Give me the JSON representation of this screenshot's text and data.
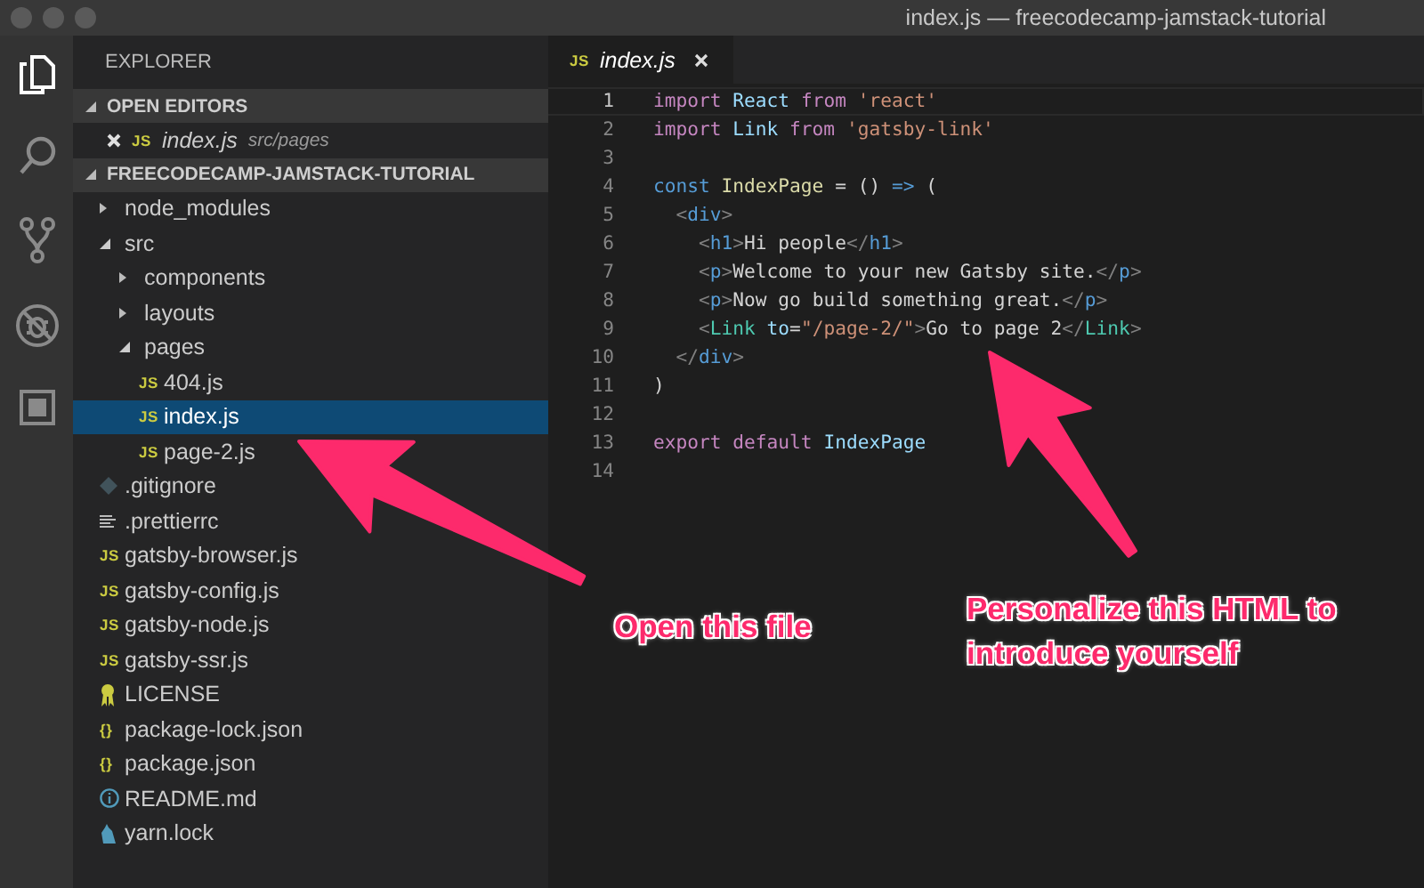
{
  "window": {
    "title": "index.js — freecodecamp-jamstack-tutorial"
  },
  "activity_bar": [
    {
      "kind": "files",
      "selected": true
    },
    {
      "kind": "search",
      "selected": false
    },
    {
      "kind": "source-control",
      "selected": false
    },
    {
      "kind": "debug",
      "selected": false
    },
    {
      "kind": "extensions",
      "selected": false
    }
  ],
  "sidebar": {
    "title": "EXPLORER",
    "sections": [
      {
        "title": "OPEN EDITORS",
        "expanded": true,
        "open_editors": [
          {
            "name": "index.js",
            "path": "src/pages",
            "kind": "js",
            "icon_text": "JS"
          }
        ]
      },
      {
        "title": "FREECODECAMP-JAMSTACK-TUTORIAL",
        "expanded": true,
        "tree": [
          {
            "name": "node_modules",
            "kind": "folder",
            "expanded": false,
            "selected": false
          },
          {
            "name": "src",
            "kind": "folder",
            "expanded": true,
            "selected": false,
            "children": [
              {
                "name": "components",
                "kind": "folder",
                "expanded": false,
                "selected": false
              },
              {
                "name": "layouts",
                "kind": "folder",
                "expanded": false,
                "selected": false
              },
              {
                "name": "pages",
                "kind": "folder",
                "expanded": true,
                "selected": false,
                "children": [
                  {
                    "name": "404.js",
                    "kind": "js",
                    "icon_text": "JS",
                    "selected": false
                  },
                  {
                    "name": "index.js",
                    "kind": "js",
                    "icon_text": "JS",
                    "selected": true
                  },
                  {
                    "name": "page-2.js",
                    "kind": "js",
                    "icon_text": "JS",
                    "selected": false
                  }
                ]
              }
            ]
          },
          {
            "name": ".gitignore",
            "kind": "git",
            "selected": false
          },
          {
            "name": ".prettierrc",
            "kind": "lines",
            "selected": false
          },
          {
            "name": "gatsby-browser.js",
            "kind": "js",
            "icon_text": "JS",
            "selected": false
          },
          {
            "name": "gatsby-config.js",
            "kind": "js",
            "icon_text": "JS",
            "selected": false
          },
          {
            "name": "gatsby-node.js",
            "kind": "js",
            "icon_text": "JS",
            "selected": false
          },
          {
            "name": "gatsby-ssr.js",
            "kind": "js",
            "icon_text": "JS",
            "selected": false
          },
          {
            "name": "LICENSE",
            "kind": "license",
            "selected": false
          },
          {
            "name": "package-lock.json",
            "kind": "json",
            "icon_text": "{}",
            "selected": false
          },
          {
            "name": "package.json",
            "kind": "json",
            "icon_text": "{}",
            "selected": false
          },
          {
            "name": "README.md",
            "kind": "info",
            "selected": false
          },
          {
            "name": "yarn.lock",
            "kind": "yarn",
            "selected": false
          }
        ]
      }
    ]
  },
  "editor": {
    "tabs": [
      {
        "name": "index.js",
        "kind": "js",
        "icon_text": "JS",
        "selected": true
      }
    ],
    "lines": [
      {
        "number": "1",
        "active": true,
        "tokens": [
          {
            "t": "import ",
            "kind": "keyword"
          },
          {
            "t": "React ",
            "kind": "var"
          },
          {
            "t": "from ",
            "kind": "keyword"
          },
          {
            "t": "'react'",
            "kind": "string"
          }
        ]
      },
      {
        "number": "2",
        "active": false,
        "tokens": [
          {
            "t": "import ",
            "kind": "keyword"
          },
          {
            "t": "Link ",
            "kind": "var"
          },
          {
            "t": "from ",
            "kind": "keyword"
          },
          {
            "t": "'gatsby-link'",
            "kind": "string"
          }
        ]
      },
      {
        "number": "3",
        "active": false
      },
      {
        "number": "4",
        "active": false,
        "tokens": [
          {
            "t": "const ",
            "kind": "storage"
          },
          {
            "t": "IndexPage ",
            "kind": "func"
          },
          {
            "t": "= () ",
            "kind": "text"
          },
          {
            "t": "=> ",
            "kind": "storage"
          },
          {
            "t": "(",
            "kind": "text"
          }
        ]
      },
      {
        "number": "5",
        "active": false,
        "tokens": [
          {
            "t": "  <",
            "kind": "bracket"
          },
          {
            "t": "div",
            "kind": "tag"
          },
          {
            "t": ">",
            "kind": "bracket"
          }
        ]
      },
      {
        "number": "6",
        "active": false,
        "tokens": [
          {
            "t": "    <",
            "kind": "bracket"
          },
          {
            "t": "h1",
            "kind": "tag"
          },
          {
            "t": ">",
            "kind": "bracket"
          },
          {
            "t": "Hi people",
            "kind": "text"
          },
          {
            "t": "</",
            "kind": "bracket"
          },
          {
            "t": "h1",
            "kind": "tag"
          },
          {
            "t": ">",
            "kind": "bracket"
          }
        ]
      },
      {
        "number": "7",
        "active": false,
        "tokens": [
          {
            "t": "    <",
            "kind": "bracket"
          },
          {
            "t": "p",
            "kind": "tag"
          },
          {
            "t": ">",
            "kind": "bracket"
          },
          {
            "t": "Welcome to your new Gatsby site.",
            "kind": "text"
          },
          {
            "t": "</",
            "kind": "bracket"
          },
          {
            "t": "p",
            "kind": "tag"
          },
          {
            "t": ">",
            "kind": "bracket"
          }
        ]
      },
      {
        "number": "8",
        "active": false,
        "tokens": [
          {
            "t": "    <",
            "kind": "bracket"
          },
          {
            "t": "p",
            "kind": "tag"
          },
          {
            "t": ">",
            "kind": "bracket"
          },
          {
            "t": "Now go build something great.",
            "kind": "text"
          },
          {
            "t": "</",
            "kind": "bracket"
          },
          {
            "t": "p",
            "kind": "tag"
          },
          {
            "t": ">",
            "kind": "bracket"
          }
        ]
      },
      {
        "number": "9",
        "active": false,
        "tokens": [
          {
            "t": "    <",
            "kind": "bracket"
          },
          {
            "t": "Link ",
            "kind": "component"
          },
          {
            "t": "to",
            "kind": "attr"
          },
          {
            "t": "=",
            "kind": "text"
          },
          {
            "t": "\"/page-2/\"",
            "kind": "string"
          },
          {
            "t": ">",
            "kind": "bracket"
          },
          {
            "t": "Go to page 2",
            "kind": "text"
          },
          {
            "t": "</",
            "kind": "bracket"
          },
          {
            "t": "Link",
            "kind": "component"
          },
          {
            "t": ">",
            "kind": "bracket"
          }
        ]
      },
      {
        "number": "10",
        "active": false,
        "tokens": [
          {
            "t": "  </",
            "kind": "bracket"
          },
          {
            "t": "div",
            "kind": "tag"
          },
          {
            "t": ">",
            "kind": "bracket"
          }
        ]
      },
      {
        "number": "11",
        "active": false,
        "tokens": [
          {
            "t": ")",
            "kind": "text"
          }
        ]
      },
      {
        "number": "12",
        "active": false
      },
      {
        "number": "13",
        "active": false,
        "tokens": [
          {
            "t": "export ",
            "kind": "keyword"
          },
          {
            "t": "default ",
            "kind": "keyword"
          },
          {
            "t": "IndexPage",
            "kind": "var"
          }
        ]
      },
      {
        "number": "14",
        "active": false
      }
    ]
  },
  "annotations": [
    {
      "text": "Open this file"
    },
    {
      "text": "Personalize this HTML to introduce yourself"
    }
  ]
}
